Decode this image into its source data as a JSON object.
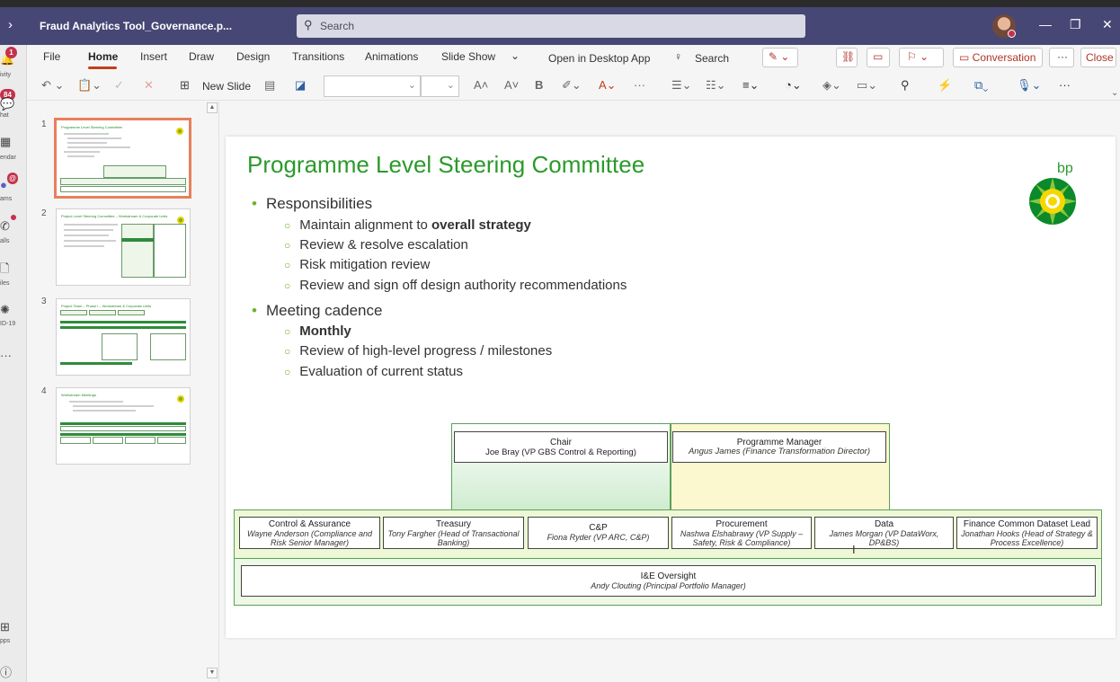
{
  "teams": {
    "doc_title": "Fraud Analytics Tool_Governance.p...",
    "search_placeholder": "Search",
    "rail": [
      {
        "label": "ivity",
        "badge": "1"
      },
      {
        "label": "hat",
        "badge": "84"
      },
      {
        "label": "endar",
        "badge": ""
      },
      {
        "label": "ams",
        "badge": "@"
      },
      {
        "label": "alls",
        "badge": ""
      },
      {
        "label": "iles",
        "badge": ""
      },
      {
        "label": "ID-19",
        "badge": ""
      },
      {
        "label": "pps",
        "badge": ""
      }
    ]
  },
  "ribbon": {
    "tabs": [
      "File",
      "Home",
      "Insert",
      "Draw",
      "Design",
      "Transitions",
      "Animations",
      "Slide Show"
    ],
    "open_desktop": "Open in Desktop App",
    "search": "Search",
    "conversation": "Conversation",
    "close": "Close",
    "new_slide": "New Slide"
  },
  "thumbnails": [
    {
      "num": "1",
      "title": "Programme Level Steering Committee"
    },
    {
      "num": "2",
      "title": "Project Level Steering Committee – Workstream & Corporate Units"
    },
    {
      "num": "3",
      "title": "Project Team – Phase I – Workstream & Corporate Units"
    },
    {
      "num": "4",
      "title": "Workstream Meetings"
    }
  ],
  "slide": {
    "title": "Programme Level Steering Committee",
    "logo_text": "bp",
    "bullets": [
      {
        "text": "Responsibilities",
        "subs": [
          {
            "pre": "Maintain alignment to ",
            "bold": "overall strategy"
          },
          {
            "pre": "Review & resolve escalation",
            "bold": ""
          },
          {
            "pre": "Risk mitigation review",
            "bold": ""
          },
          {
            "pre": "Review and sign off design authority recommendations",
            "bold": ""
          }
        ]
      },
      {
        "text": "Meeting cadence",
        "subs": [
          {
            "pre": "",
            "bold": "Monthly"
          },
          {
            "pre": "Review of high-level progress / milestones",
            "bold": ""
          },
          {
            "pre": "Evaluation of current status",
            "bold": ""
          }
        ]
      }
    ],
    "org": {
      "chair": {
        "title": "Chair",
        "name": "Joe Bray (VP GBS Control & Reporting)"
      },
      "pm": {
        "title": "Programme Manager",
        "name": "Angus James (Finance Transformation Director)"
      },
      "members": [
        {
          "title": "Control & Assurance",
          "name": "Wayne Anderson (Compliance and Risk Senior Manager)"
        },
        {
          "title": "Treasury",
          "name": "Tony Fargher (Head of Transactional Banking)"
        },
        {
          "title": "C&P",
          "name": "Fiona Ryder (VP ARC, C&P)"
        },
        {
          "title": "Procurement",
          "name": "Nashwa Elshabrawy (VP  Supply – Safety, Risk & Compliance)"
        },
        {
          "title": "Data",
          "name": "James Morgan (VP DataWorx, DP&BS)"
        },
        {
          "title": "Finance Common Dataset Lead",
          "name": "Jonathan Hooks (Head of Strategy & Process Excellence)"
        }
      ],
      "oversight": {
        "title": "I&E Oversight",
        "name": "Andy Clouting (Principal Portfolio Manager)"
      }
    }
  }
}
